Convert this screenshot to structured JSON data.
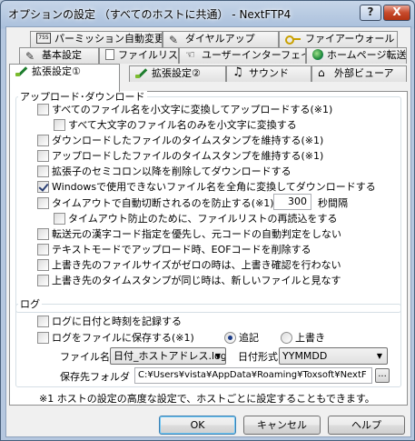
{
  "window": {
    "title": "オプションの設定 （すべてのホストに共通） - NextFTP4",
    "help_button": "?",
    "close_button": "X"
  },
  "tabs": {
    "row1": [
      {
        "label": "パーミッション自動変更",
        "icon": "keyboard-icon"
      },
      {
        "label": "ダイヤルアップ",
        "icon": "pen-icon"
      },
      {
        "label": "ファイアーウォール",
        "icon": "key-icon"
      }
    ],
    "row2": [
      {
        "label": "基本設定",
        "icon": "pen-icon"
      },
      {
        "label": "ファイルリスト",
        "icon": "list-icon"
      },
      {
        "label": "ユーザーインターフェイス",
        "icon": "hand-icon"
      },
      {
        "label": "ホームページ転送",
        "icon": "globe-icon"
      }
    ],
    "row3": [
      {
        "label": "拡張設定①",
        "icon": "brush-icon",
        "active": true
      },
      {
        "label": "拡張設定②",
        "icon": "brush-icon"
      },
      {
        "label": "サウンド",
        "icon": "music-note-icon"
      },
      {
        "label": "外部ビューア",
        "icon": "viewer-icon"
      }
    ]
  },
  "upload_download": {
    "group_label": "アップロード･ダウンロード",
    "options": [
      {
        "label": "すべてのファイル名を小文字に変換してアップロードする(※1)",
        "checked": false
      },
      {
        "label": "すべて大文字のファイル名のみを小文字に変換する",
        "checked": false
      },
      {
        "label": "ダウンロードしたファイルのタイムスタンプを維持する(※1)",
        "checked": false
      },
      {
        "label": "アップロードしたファイルのタイムスタンプを維持する(※1)",
        "checked": false
      },
      {
        "label": "拡張子のセミコロン以降を削除してダウンロードする",
        "checked": false
      },
      {
        "label": "Windowsで使用できないファイル名を全角に変換してダウンロードする",
        "checked": true
      },
      {
        "label": "タイムアウトで自動切断されるのを防止する(※1)",
        "checked": false
      },
      {
        "label": "タイムアウト防止のために、ファイルリストの再読込をする",
        "checked": false
      },
      {
        "label": "転送元の漢字コード指定を優先し、元コードの自動判定をしない",
        "checked": false
      },
      {
        "label": "テキストモードでアップロード時、EOFコードを削除する",
        "checked": false
      },
      {
        "label": "上書き先のファイルサイズがゼロの時は、上書き確認を行わない",
        "checked": false
      },
      {
        "label": "上書き先のタイムスタンプが同じ時は、新しいファイルと見なす",
        "checked": false
      }
    ],
    "timeout_value": "300",
    "timeout_unit": "秒間隔"
  },
  "log": {
    "group_label": "ログ",
    "datetime_option": {
      "label": "ログに日付と時刻を記録する",
      "checked": false
    },
    "save_option": {
      "label": "ログをファイルに保存する(※1)",
      "checked": false
    },
    "mode_append": {
      "label": "追記",
      "selected": true
    },
    "mode_overwrite": {
      "label": "上書き",
      "selected": false
    },
    "filename_label": "ファイル名",
    "filename_value": "日付_ホストアドレス.log",
    "dateformat_label": "日付形式",
    "dateformat_value": "YYMMDD",
    "folder_label": "保存先フォルダ",
    "folder_value": "C:¥Users¥vista¥AppData¥Roaming¥Toxsoft¥NextF",
    "browse_button": "..."
  },
  "footnote": "※1 ホストの設定の高度な設定で、ホストごとに設定することもできます。",
  "buttons": {
    "ok": "OK",
    "cancel": "キャンセル",
    "help": "ヘルプ"
  }
}
